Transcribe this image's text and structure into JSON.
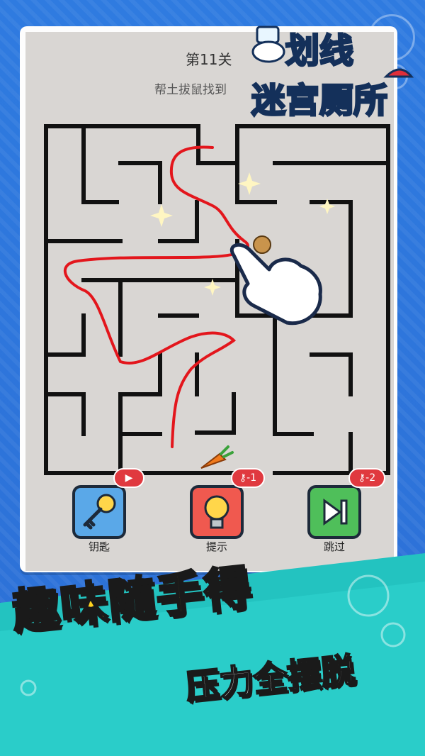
{
  "header": {
    "level_title": "第11关",
    "hint": "帮土拔鼠找到"
  },
  "logo": {
    "line1": "划线",
    "line2": "迷宫厕所"
  },
  "buttons": [
    {
      "label": "钥匙",
      "badge_icon": "video-icon",
      "badge_text": ""
    },
    {
      "label": "提示",
      "badge_icon": "key-icon",
      "badge_text": "-1"
    },
    {
      "label": "跳过",
      "badge_icon": "key-icon",
      "badge_text": "-2"
    }
  ],
  "slogan": {
    "main": "趣味随手得",
    "sub": "压力全摆脱"
  },
  "colors": {
    "background": "#2c6fd6",
    "maze_wall": "#111111",
    "drawn_path": "#e3161c",
    "key_button": "#5aa8e8",
    "hint_button": "#f0594f",
    "skip_button": "#4fbf5a",
    "slogan_yellow": "#ffd21e",
    "bottom_band": "#23c3c0"
  }
}
